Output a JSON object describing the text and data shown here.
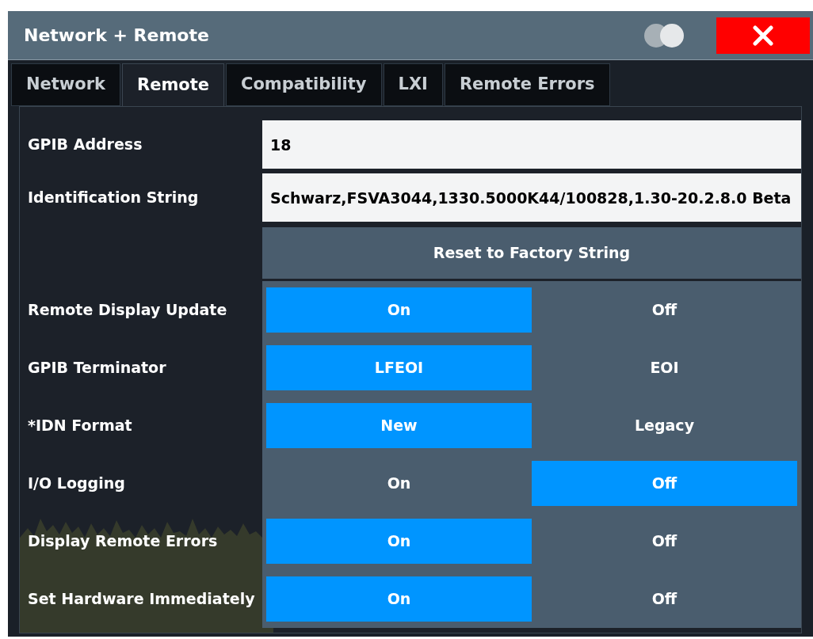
{
  "window": {
    "title": "Network + Remote"
  },
  "tabs": [
    {
      "label": "Network",
      "selected": false
    },
    {
      "label": "Remote",
      "selected": true
    },
    {
      "label": "Compatibility",
      "selected": false
    },
    {
      "label": "LXI",
      "selected": false
    },
    {
      "label": "Remote Errors",
      "selected": false
    }
  ],
  "fields": [
    {
      "label": "GPIB Address",
      "value": "18"
    },
    {
      "label": "Identification String",
      "value": "Schwarz,FSVA3044,1330.5000K44/100828,1.30-20.2.8.0 Beta"
    }
  ],
  "reset_button": "Reset to Factory String",
  "toggles": [
    {
      "label": "Remote Display Update",
      "options": [
        {
          "label": "On",
          "selected": true
        },
        {
          "label": "Off",
          "selected": false
        }
      ]
    },
    {
      "label": "GPIB Terminator",
      "options": [
        {
          "label": "LFEOI",
          "selected": true
        },
        {
          "label": "EOI",
          "selected": false
        }
      ]
    },
    {
      "label": "*IDN Format",
      "options": [
        {
          "label": "New",
          "selected": true
        },
        {
          "label": "Legacy",
          "selected": false
        }
      ]
    },
    {
      "label": "I/O Logging",
      "options": [
        {
          "label": "On",
          "selected": false
        },
        {
          "label": "Off",
          "selected": true
        }
      ]
    },
    {
      "label": "Display Remote Errors",
      "options": [
        {
          "label": "On",
          "selected": true
        },
        {
          "label": "Off",
          "selected": false
        }
      ]
    },
    {
      "label": "Set Hardware Immediately",
      "options": [
        {
          "label": "On",
          "selected": true
        },
        {
          "label": "Off",
          "selected": false
        }
      ]
    }
  ]
}
